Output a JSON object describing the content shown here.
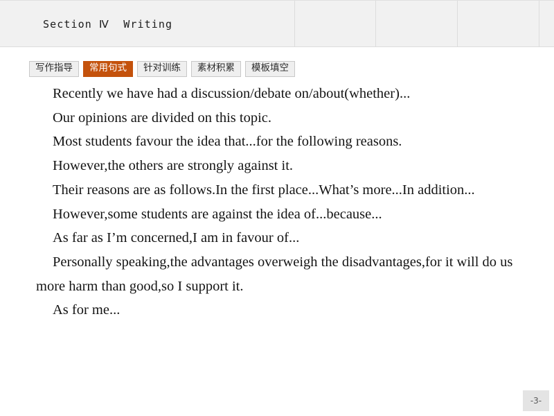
{
  "header": {
    "title": "Section Ⅳ  Writing",
    "background_color": "#f1f1f1",
    "divider_color": "#dcdcdc",
    "divider_positions": [
      425,
      542,
      660,
      778
    ]
  },
  "tabs": {
    "active_color": "#c4520c",
    "inactive_color": "#efefef",
    "items": [
      {
        "label": "写作指导",
        "active": false
      },
      {
        "label": "常用句式",
        "active": true
      },
      {
        "label": "针对训练",
        "active": false
      },
      {
        "label": "素材积累",
        "active": false
      },
      {
        "label": "模板填空",
        "active": false
      }
    ]
  },
  "body": {
    "lines": [
      {
        "text": "Recently we have had a discussion/debate on/about(whether)...",
        "indented": true
      },
      {
        "text": "Our opinions are divided on this topic.",
        "indented": true
      },
      {
        "text": "Most students favour the idea that...for the following reasons.",
        "indented": true
      },
      {
        "text": "However,the others are strongly against it.",
        "indented": true
      },
      {
        "text": "Their reasons are as follows.In the first place...What’s more...In addition...",
        "indented": true
      },
      {
        "text": "However,some students are against the idea of...because...",
        "indented": true
      },
      {
        "text": "As far as I’m concerned,I am in favour of...",
        "indented": true
      },
      {
        "text": "Personally speaking,the advantages overweigh the disadvantages,for it will do us more harm than good,so I support it.",
        "indented": true
      },
      {
        "text": "As for me...",
        "indented": true
      }
    ]
  },
  "footer": {
    "page_number": "-3-",
    "badge_color": "#e4e4e4"
  }
}
